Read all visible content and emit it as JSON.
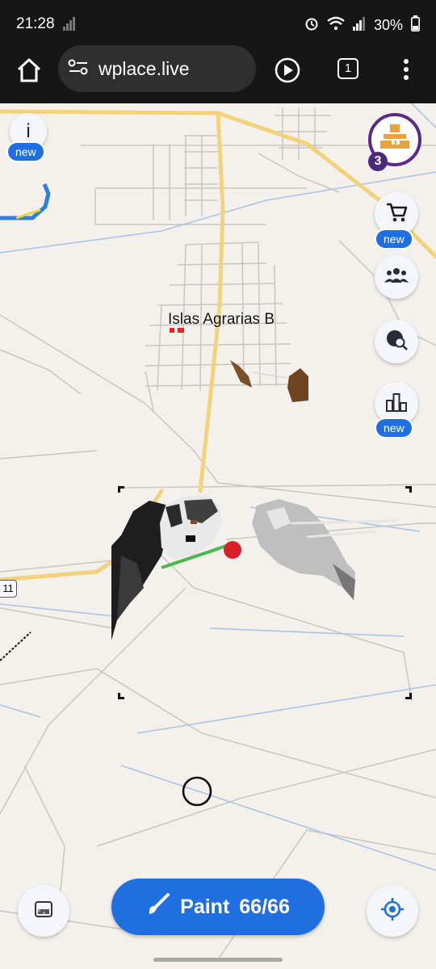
{
  "status": {
    "time": "21:28",
    "battery": "30%"
  },
  "browser": {
    "url": "wplace.live",
    "tab_count": "1"
  },
  "map": {
    "place_label": "Islas Agrarias B",
    "road_number": "11"
  },
  "controls": {
    "info_label": "i",
    "info_badge": "new",
    "profile_level": "3",
    "shop_badge": "new",
    "leaderboard_badge": "new",
    "paint_label": "Paint",
    "paint_charges": "66/66"
  },
  "colors": {
    "accent": "#1f6fe0",
    "profile_ring": "#5b2a86",
    "avatar": "#e8a33a"
  },
  "icons": [
    "home-icon",
    "site-settings-icon",
    "play-icon",
    "tab-switcher-icon",
    "more-icon",
    "cart-icon",
    "people-icon",
    "globe-search-icon",
    "bar-chart-icon",
    "brush-icon",
    "locate-icon",
    "palette-icon"
  ]
}
